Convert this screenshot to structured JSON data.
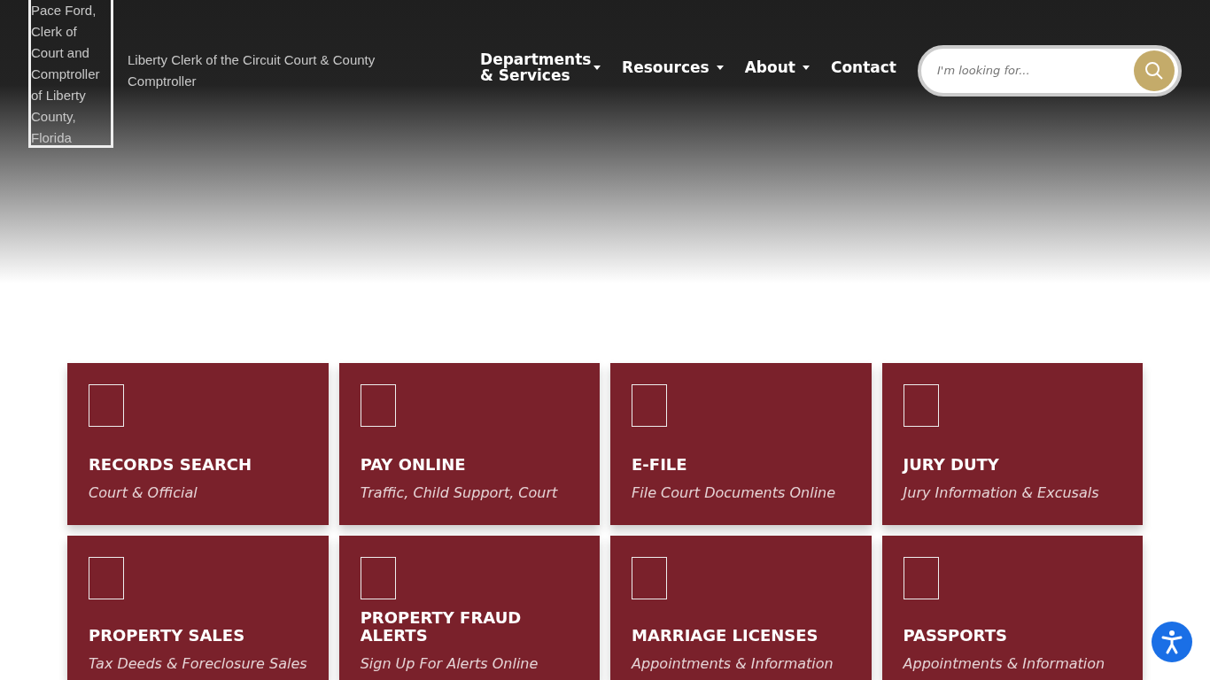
{
  "header": {
    "portrait_alt": "Pace Ford, Clerk of Court and Comptroller of Liberty County, Florida",
    "logo_alt": "Liberty Clerk of the Circuit Court & County Comptroller",
    "nav": [
      {
        "label": "Departments & Services",
        "dropdown": true
      },
      {
        "label": "Resources",
        "dropdown": true
      },
      {
        "label": "About",
        "dropdown": true
      },
      {
        "label": "Contact",
        "dropdown": false
      }
    ],
    "search": {
      "placeholder": "I'm looking for..."
    }
  },
  "tiles": [
    {
      "title": "RECORDS SEARCH",
      "subtitle": "Court & Official"
    },
    {
      "title": "PAY ONLINE",
      "subtitle": "Traffic, Child Support, Court"
    },
    {
      "title": "E-FILE",
      "subtitle": "File Court Documents Online"
    },
    {
      "title": "JURY DUTY",
      "subtitle": "Jury Information & Excusals"
    },
    {
      "title": "PROPERTY SALES",
      "subtitle": "Tax Deeds & Foreclosure Sales"
    },
    {
      "title": "PROPERTY FRAUD ALERTS",
      "subtitle": "Sign Up For Alerts Online"
    },
    {
      "title": "MARRIAGE LICENSES",
      "subtitle": "Appointments & Information"
    },
    {
      "title": "PASSPORTS",
      "subtitle": "Appointments & Information"
    }
  ]
}
